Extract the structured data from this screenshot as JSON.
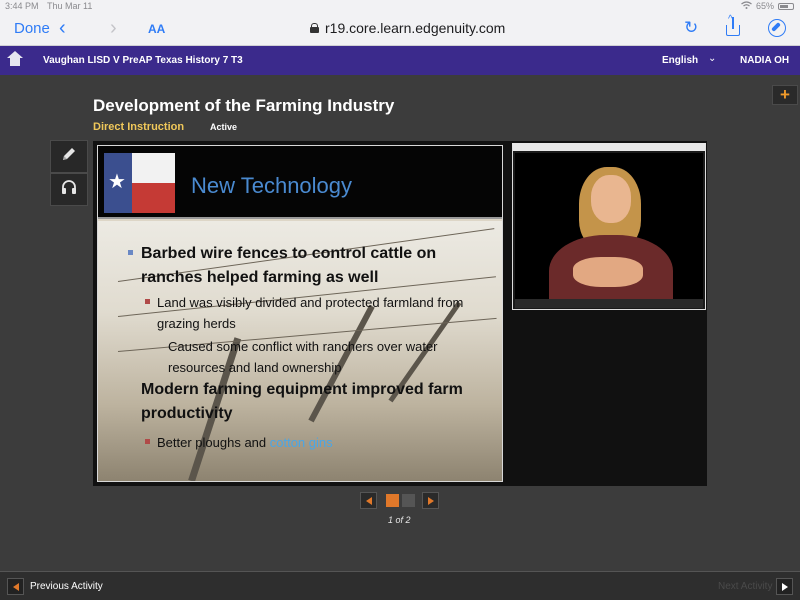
{
  "status_bar": {
    "time": "3:44 PM",
    "date": "Thu Mar 11",
    "battery": "65%"
  },
  "browser": {
    "done_label": "Done",
    "text_size_label": "AA",
    "url": "r19.core.learn.edgenuity.com"
  },
  "course_bar": {
    "course_title": "Vaughan LISD V PreAP Texas History 7 T3",
    "language": "English",
    "user": "NADIA OH"
  },
  "lesson": {
    "title": "Development of the Farming Industry",
    "activity_type": "Direct Instruction",
    "status": "Active"
  },
  "slide": {
    "title": "New Technology",
    "bullet1": "Barbed wire fences to control cattle on ranches helped farming as well",
    "sub1": "Land was visibly divided and protected farmland from grazing herds",
    "sub2": "Caused some conflict with ranchers over water resources and land ownership",
    "bullet2": "Modern farming equipment improved farm productivity",
    "sub3_prefix": "Better ploughs and ",
    "sub3_highlight": "cotton gins"
  },
  "pager": {
    "current_page": 1,
    "total_pages": 2,
    "label": "1 of 2"
  },
  "footer": {
    "previous_label": "Previous Activity",
    "next_label": "Next Activity"
  },
  "colors": {
    "course_bar": "#3b2a8c",
    "accent_orange": "#e0782a",
    "subtitle_gold": "#f0c85a",
    "slide_title_blue": "#4a8ad0",
    "ios_blue": "#2f7cf6"
  },
  "icons": [
    "home-icon",
    "pencil-icon",
    "headphones-icon",
    "plus-icon",
    "lock-icon",
    "reload-icon",
    "share-icon",
    "compass-icon",
    "wifi-icon",
    "battery-icon"
  ]
}
